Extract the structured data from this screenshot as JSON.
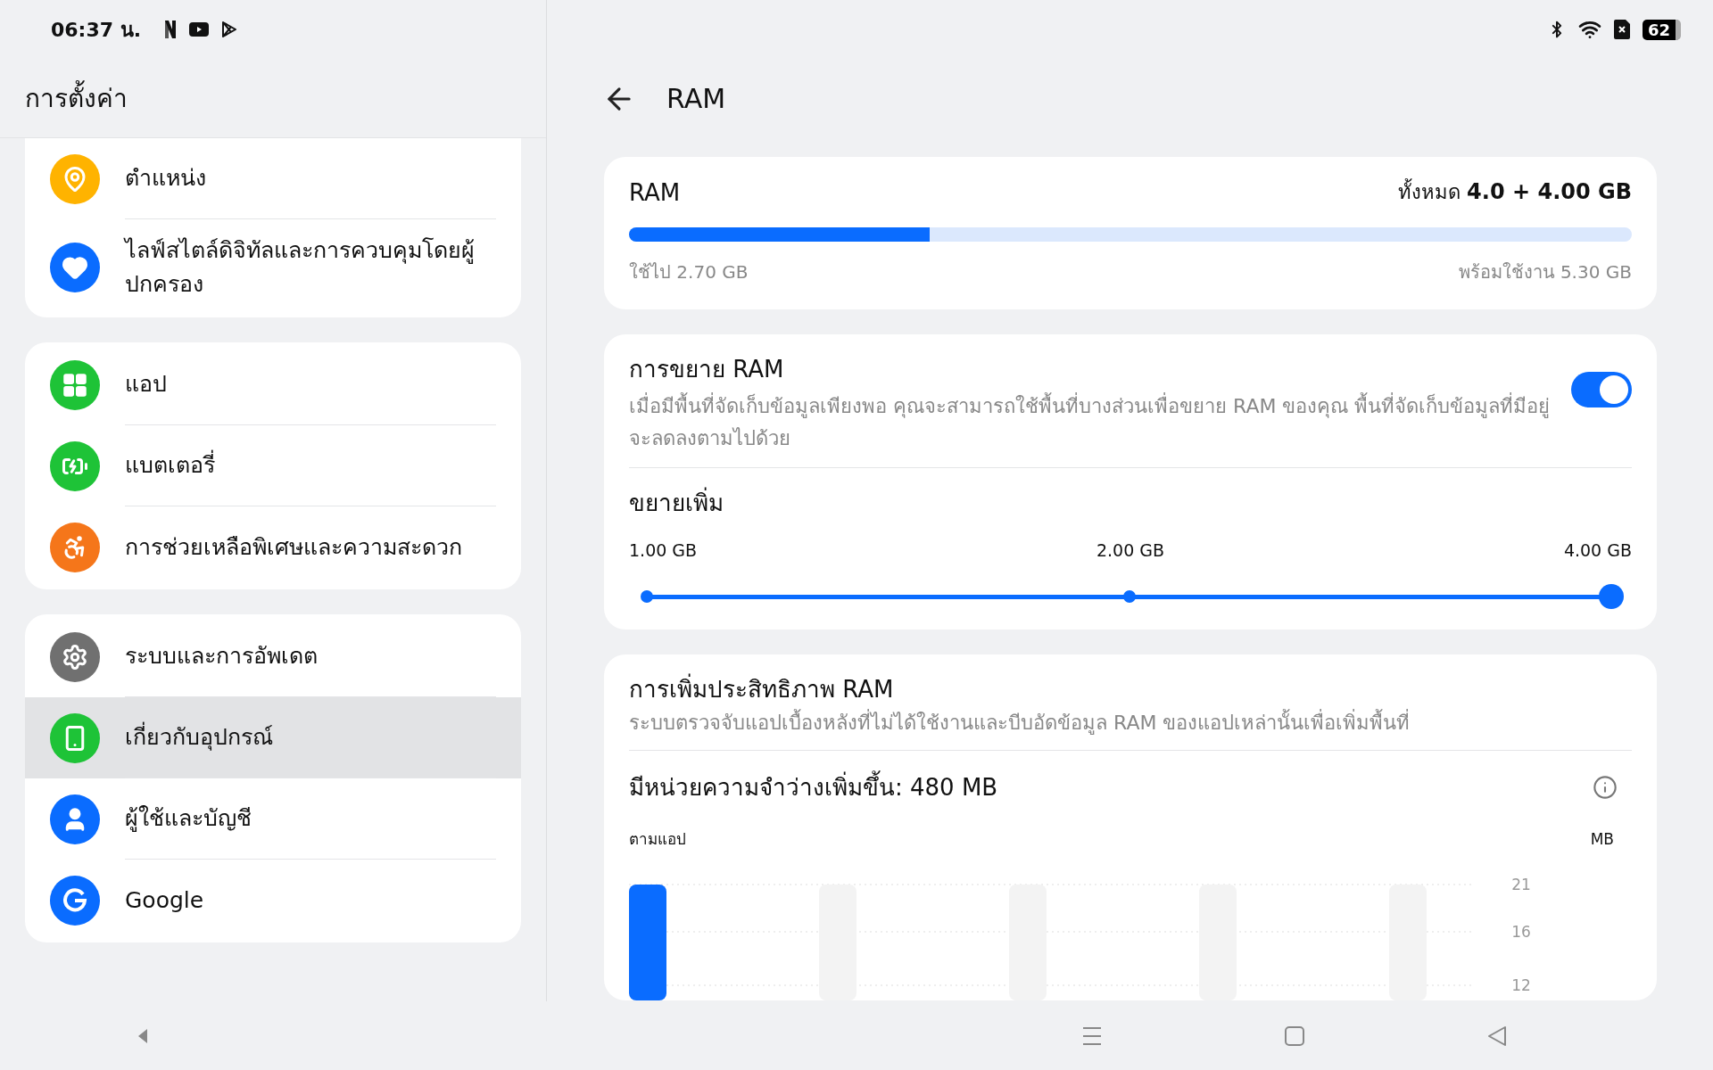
{
  "status_bar": {
    "time": "06:37 น.",
    "battery": "62"
  },
  "sidebar": {
    "title": "การตั้งค่า",
    "groups": [
      {
        "items": [
          {
            "label": "ตำแหน่ง",
            "color": "#ffb300",
            "selected": false
          },
          {
            "label": "ไลฟ์สไตล์ดิจิทัลและการควบคุมโดยผู้ปกครอง",
            "color": "#0a6cff",
            "selected": false
          }
        ]
      },
      {
        "items": [
          {
            "label": "แอป",
            "color": "#1ec337",
            "selected": false
          },
          {
            "label": "แบตเตอรี่",
            "color": "#1ec337",
            "selected": false
          },
          {
            "label": "การช่วยเหลือพิเศษและความสะดวก",
            "color": "#f5761a",
            "selected": false
          }
        ]
      },
      {
        "items": [
          {
            "label": "ระบบและการอัพเดต",
            "color": "#707070",
            "selected": false
          },
          {
            "label": "เกี่ยวกับอุปกรณ์",
            "color": "#1ec337",
            "selected": true
          },
          {
            "label": "ผู้ใช้และบัญชี",
            "color": "#0a6cff",
            "selected": false
          },
          {
            "label": "Google",
            "color": "#0a6cff",
            "selected": false
          }
        ]
      }
    ]
  },
  "page": {
    "title": "RAM"
  },
  "ram_card": {
    "title": "RAM",
    "total": "ทั้งหมด **4.0 + 4.00 GB**",
    "level": 0.3,
    "used": "ใช้ไป 2.70 GB",
    "available": "พร้อมใช้งาน 5.30 GB"
  },
  "expansion": {
    "title": "การขยาย RAM",
    "description": "เมื่อมีพื้นที่จัดเก็บข้อมูลเพียงพอ คุณจะสามารถใช้พื้นที่บางส่วนเพื่อขยาย RAM ของคุณ พื้นที่จัดเก็บข้อมูลที่มีอยู่จะลดลงตามไปด้วย",
    "on": true,
    "subtitle": "ขยายเพิ่ม",
    "options": [
      {
        "label": "1.00 GB",
        "selected": false
      },
      {
        "label": "2.00 GB",
        "selected": false
      },
      {
        "label": "4.00 GB",
        "selected": true
      }
    ]
  },
  "optimization": {
    "title": "การเพิ่มประสิทธิภาพ RAM",
    "description": "ระบบตรวจจับแอปเบื้องหลังที่ไม่ได้ใช้งานและบีบอัดข้อมูล RAM ของแอปเหล่านั้นเพื่อเพิ่มพื้นที่",
    "freed": "มีหน่วยความจำว่างเพิ่มขึ้น: 480 MB",
    "chart": {
      "label": "ตามแอป",
      "unit": "MB",
      "tick_labels": [
        "21",
        "16",
        "12"
      ]
    }
  },
  "nav": [
    {
      "kind": "collapse"
    },
    {
      "kind": "recents"
    },
    {
      "kind": "home"
    },
    {
      "kind": "back"
    }
  ]
}
